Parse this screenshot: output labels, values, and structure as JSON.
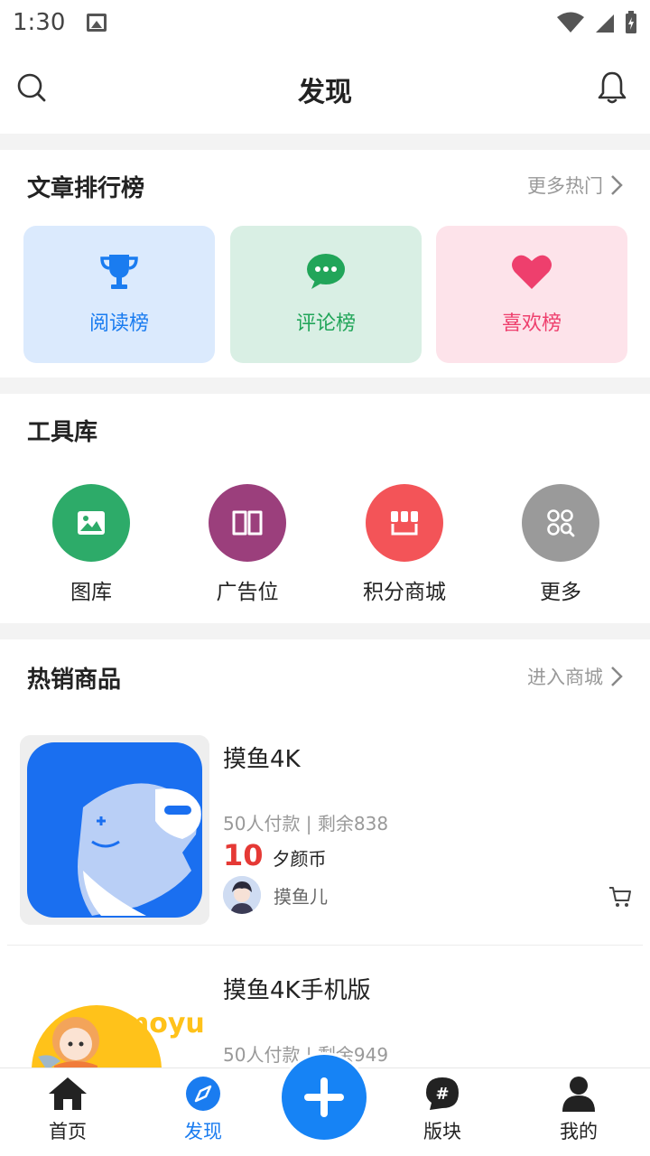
{
  "status_bar": {
    "time": "1:30"
  },
  "header": {
    "title": "发现"
  },
  "rankings": {
    "title": "文章排行榜",
    "more": "更多热门",
    "items": [
      {
        "label": "阅读榜",
        "icon": "trophy-icon",
        "bg": "#dbeafd",
        "color": "#1a7cf0"
      },
      {
        "label": "评论榜",
        "icon": "chat-bubble-icon",
        "bg": "#d9efe4",
        "color": "#21a559"
      },
      {
        "label": "喜欢榜",
        "icon": "heart-icon",
        "bg": "#fde3ea",
        "color": "#ee3f6d"
      }
    ]
  },
  "tools": {
    "title": "工具库",
    "items": [
      {
        "label": "图库",
        "icon": "image-icon",
        "color": "#2dab69"
      },
      {
        "label": "广告位",
        "icon": "book-icon",
        "color": "#9b3f7c"
      },
      {
        "label": "积分商城",
        "icon": "shop-icon",
        "color": "#f35458"
      },
      {
        "label": "更多",
        "icon": "grid-search-icon",
        "color": "#9a9a9a"
      }
    ]
  },
  "hot_products": {
    "title": "热销商品",
    "more": "进入商城",
    "items": [
      {
        "name": "摸鱼4K",
        "stats": "50人付款 | 剩余838",
        "price": "10",
        "unit": "夕颜币",
        "seller": "摸鱼儿"
      },
      {
        "name": "摸鱼4K手机版",
        "stats": "50人付款 | 剩余949",
        "thumb_text": "moyu"
      }
    ]
  },
  "bottom_nav": {
    "items": [
      {
        "label": "首页",
        "icon": "home-icon"
      },
      {
        "label": "发现",
        "icon": "compass-icon",
        "active": true
      },
      {
        "label": "版块",
        "icon": "hashtag-icon"
      },
      {
        "label": "我的",
        "icon": "user-icon"
      }
    ]
  }
}
